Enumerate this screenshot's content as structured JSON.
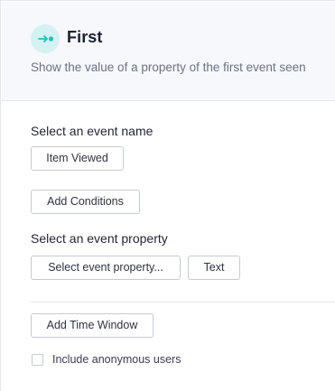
{
  "header": {
    "icon": "arrow-to-dot-icon",
    "title": "First",
    "description": "Show the value of a property of the first event seen"
  },
  "event_name": {
    "label": "Select an event name",
    "value": "Item Viewed"
  },
  "conditions": {
    "button_label": "Add Conditions"
  },
  "event_property": {
    "label": "Select an event property",
    "select_label": "Select event property...",
    "type_label": "Text"
  },
  "time_window": {
    "button_label": "Add Time Window"
  },
  "anonymous": {
    "label": "Include anonymous users",
    "checked": false
  },
  "colors": {
    "accent": "#2cbcb8",
    "icon_background": "#d3f2f1",
    "header_background": "#f6f8fc"
  }
}
